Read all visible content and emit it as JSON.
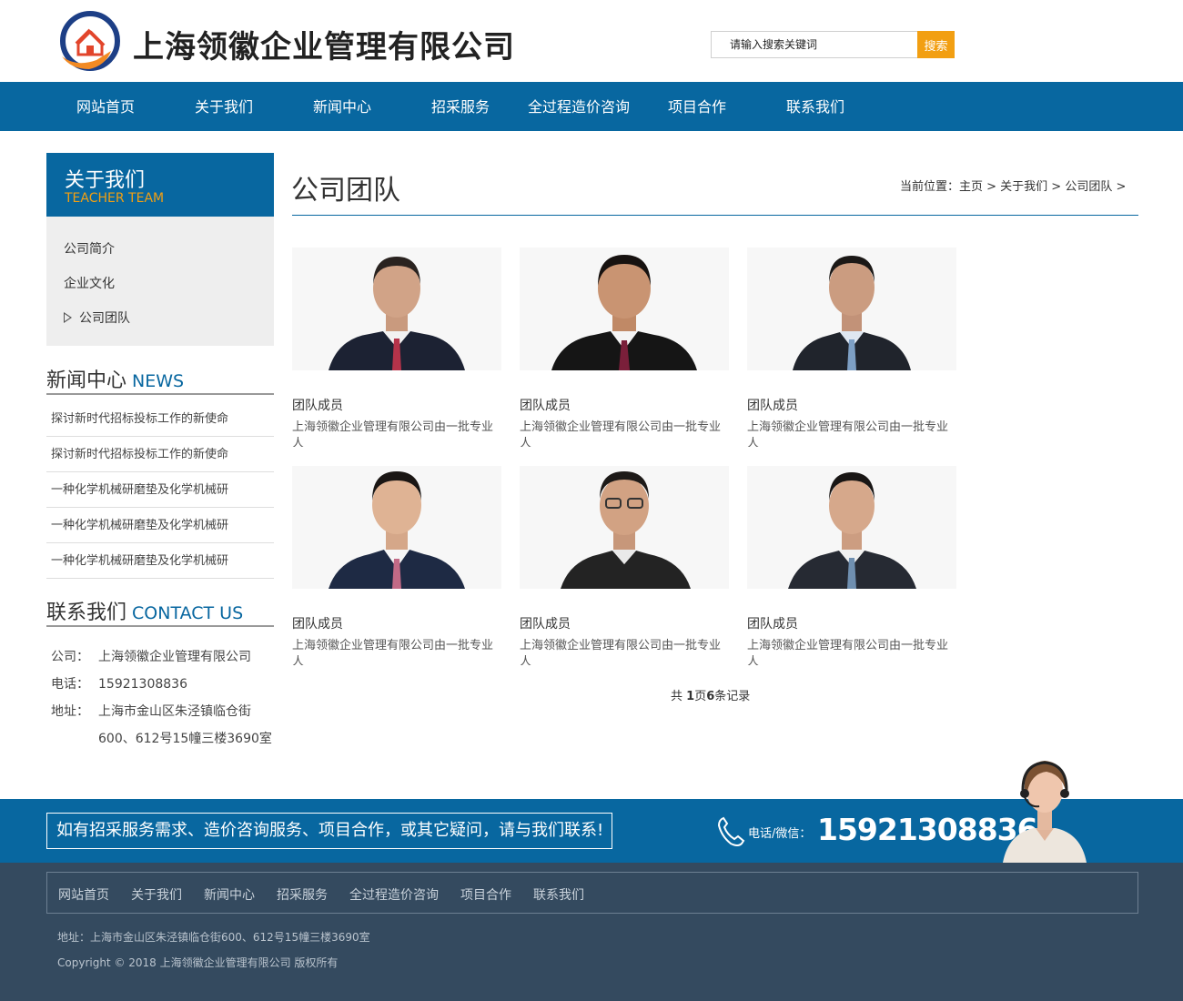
{
  "header": {
    "brand": "上海领徽企业管理有限公司",
    "search_placeholder": "请输入搜索关键词",
    "search_button": "搜索"
  },
  "nav": [
    "网站首页",
    "关于我们",
    "新闻中心",
    "招采服务",
    "全过程造价咨询",
    "项目合作",
    "联系我们"
  ],
  "sidebar": {
    "title": "关于我们",
    "subtitle": "TEACHER TEAM",
    "menu": [
      "公司简介",
      "企业文化",
      "公司团队"
    ],
    "active_index": 2,
    "news_heading_cn": "新闻中心",
    "news_heading_en": "NEWS",
    "news": [
      "探讨新时代招标投标工作的新使命",
      "探讨新时代招标投标工作的新使命",
      "一种化学机械研磨垫及化学机械研",
      "一种化学机械研磨垫及化学机械研",
      "一种化学机械研磨垫及化学机械研"
    ],
    "contact_heading_cn": "联系我们",
    "contact_heading_en": "CONTACT US",
    "contact": {
      "company_label": "公司：",
      "company": "上海领徽企业管理有限公司",
      "phone_label": "电话：",
      "phone": "15921308836",
      "address_label": "地址：",
      "address_line1": "上海市金山区朱泾镇临仓街",
      "address_line2": "600、612号15幢三楼3690室"
    }
  },
  "main": {
    "title": "公司团队",
    "breadcrumb": "当前位置：主页 > 关于我们 > 公司团队 >",
    "members": [
      {
        "title": "团队成员",
        "desc": "上海领徽企业管理有限公司由一批专业人"
      },
      {
        "title": "团队成员",
        "desc": "上海领徽企业管理有限公司由一批专业人"
      },
      {
        "title": "团队成员",
        "desc": "上海领徽企业管理有限公司由一批专业人"
      },
      {
        "title": "团队成员",
        "desc": "上海领徽企业管理有限公司由一批专业人"
      },
      {
        "title": "团队成员",
        "desc": "上海领徽企业管理有限公司由一批专业人"
      },
      {
        "title": "团队成员",
        "desc": "上海领徽企业管理有限公司由一批专业人"
      }
    ],
    "pager": {
      "prefix": "共 ",
      "pages": "1",
      "mid": "页",
      "records": "6",
      "suffix": "条记录"
    }
  },
  "banner": {
    "text": "如有招采服务需求、造价咨询服务、项目合作，或其它疑问，请与我们联系!",
    "phone_label": "电话/微信：",
    "phone_number": "15921308836"
  },
  "footer": {
    "nav": [
      "网站首页",
      "关于我们",
      "新闻中心",
      "招采服务",
      "全过程造价咨询",
      "项目合作",
      "联系我们"
    ],
    "address": "地址：上海市金山区朱泾镇临仓街600、612号15幢三楼3690室",
    "copyright": "Copyright © 2018 上海领徽企业管理有限公司 版权所有"
  },
  "colors": {
    "primary": "#0867a0",
    "accent": "#f29f12",
    "footer": "#344a5f"
  },
  "icons": [
    "house-hand-logo-icon",
    "phone-icon",
    "play-arrow-icon"
  ]
}
